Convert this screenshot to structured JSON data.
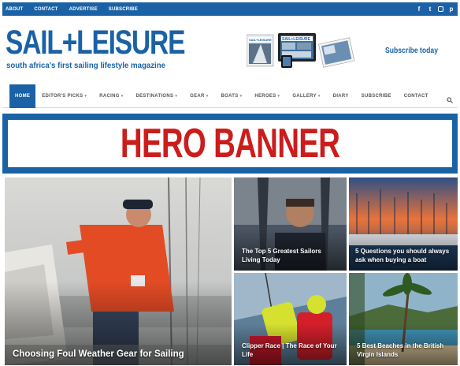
{
  "topbar": {
    "links": [
      "ABOUT",
      "CONTACT",
      "ADVERTISE",
      "SUBSCRIBE"
    ],
    "social": [
      "facebook-icon",
      "twitter-icon",
      "instagram-icon",
      "pinterest-icon"
    ]
  },
  "header": {
    "logo": "SAIL+LEISURE",
    "tagline": "south africa's first sailing lifestyle magazine",
    "magazine_mastheads": [
      "SAIL+LEISURE",
      "SAIL+LEISURE"
    ],
    "subscribe": "Subscribe today"
  },
  "nav": {
    "items": [
      {
        "label": "HOME",
        "dropdown": false,
        "active": true
      },
      {
        "label": "EDITOR'S PICKS",
        "dropdown": true
      },
      {
        "label": "RACING",
        "dropdown": true
      },
      {
        "label": "DESTINATIONS",
        "dropdown": true
      },
      {
        "label": "GEAR",
        "dropdown": true
      },
      {
        "label": "BOATS",
        "dropdown": true
      },
      {
        "label": "HEROES",
        "dropdown": true
      },
      {
        "label": "GALLERY",
        "dropdown": true
      },
      {
        "label": "DIARY",
        "dropdown": false
      },
      {
        "label": "SUBSCRIBE",
        "dropdown": false
      },
      {
        "label": "CONTACT",
        "dropdown": false
      }
    ],
    "search_icon": "search-icon"
  },
  "hero": {
    "text": "HERO BANNER"
  },
  "articles": [
    {
      "title": "Choosing Foul Weather Gear for Sailing"
    },
    {
      "title": "The Top 5 Greatest Sailors Living Today"
    },
    {
      "title": "5 Questions you should always ask when buying a boat"
    },
    {
      "title": "Clipper Race | The Race of Your Life"
    },
    {
      "title": "5 Best Beaches in the British Virgin Islands"
    }
  ],
  "colors": {
    "brand_blue": "#1a62a5",
    "hero_red": "#cc1d1d"
  }
}
